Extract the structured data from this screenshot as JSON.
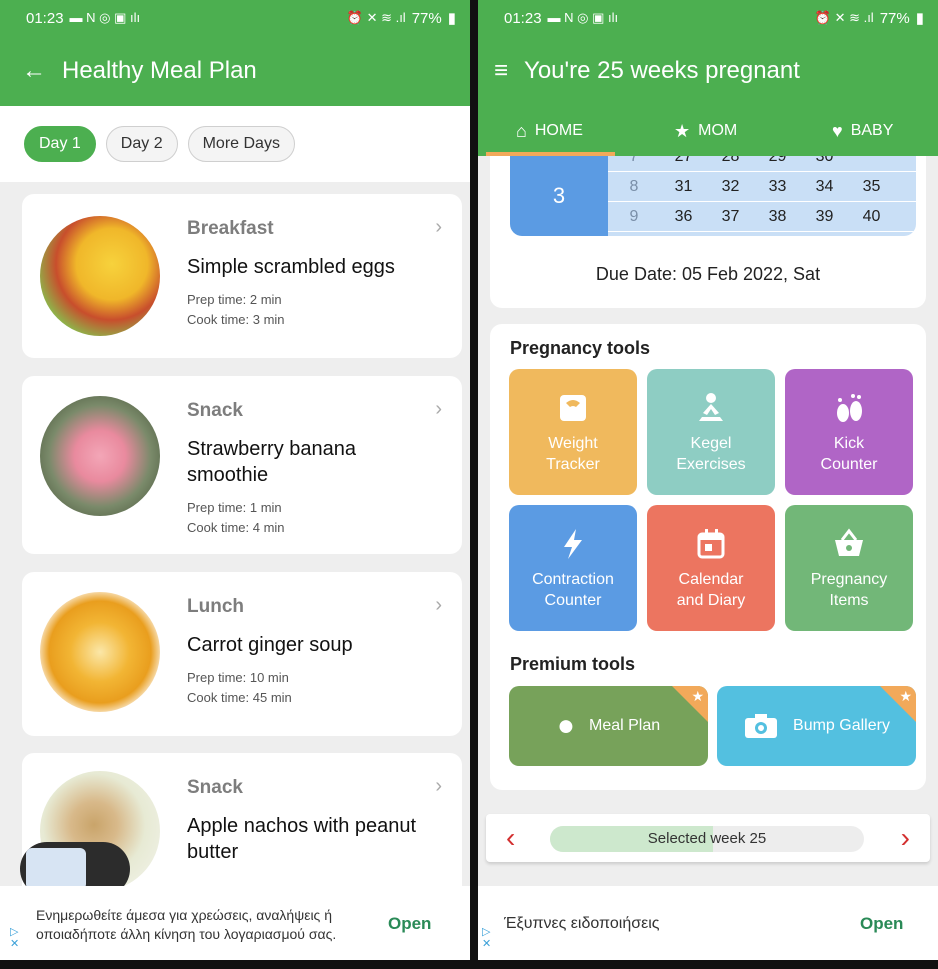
{
  "left": {
    "status": {
      "time": "01:23",
      "battery": "77%"
    },
    "title": "Healthy Meal Plan",
    "days": [
      "Day 1",
      "Day 2",
      "More Days"
    ],
    "meals": [
      {
        "category": "Breakfast",
        "name": "Simple scrambled eggs",
        "prep": "Prep time: 2 min",
        "cook": "Cook time: 3 min"
      },
      {
        "category": "Snack",
        "name": "Strawberry banana smoothie",
        "prep": "Prep time: 1 min",
        "cook": "Cook time: 4 min"
      },
      {
        "category": "Lunch",
        "name": "Carrot ginger soup",
        "prep": "Prep time: 10 min",
        "cook": "Cook time: 45 min"
      },
      {
        "category": "Snack",
        "name": "Apple nachos with peanut butter",
        "prep": "",
        "cook": ""
      }
    ],
    "ad": {
      "text": "Ενημερωθείτε άμεσα για χρεώσεις, αναλήψεις ή οποιαδήποτε άλλη κίνηση του λογαριασμού σας.",
      "open": "Open"
    }
  },
  "right": {
    "status": {
      "time": "01:23",
      "battery": "77%"
    },
    "title": "You're 25 weeks pregnant",
    "tabs": [
      "HOME",
      "MOM",
      "BABY"
    ],
    "calendar": {
      "month": "3",
      "rows": [
        {
          "week": "7",
          "days": [
            "27",
            "28",
            "29",
            "30",
            ""
          ]
        },
        {
          "week": "8",
          "days": [
            "31",
            "32",
            "33",
            "34",
            "35"
          ]
        },
        {
          "week": "9",
          "days": [
            "36",
            "37",
            "38",
            "39",
            "40"
          ]
        }
      ]
    },
    "due_date": "Due Date: 05 Feb 2022, Sat",
    "pregnancy_tools_title": "Pregnancy tools",
    "tools": [
      {
        "line1": "Weight",
        "line2": "Tracker",
        "color": "#f0b95d",
        "icon": "scale-icon"
      },
      {
        "line1": "Kegel",
        "line2": "Exercises",
        "color": "#8ecdc3",
        "icon": "meditation-icon"
      },
      {
        "line1": "Kick",
        "line2": "Counter",
        "color": "#b065c6",
        "icon": "footprint-icon"
      },
      {
        "line1": "Contraction",
        "line2": "Counter",
        "color": "#5b9be3",
        "icon": "lightning-icon"
      },
      {
        "line1": "Calendar",
        "line2": "and Diary",
        "color": "#ec7560",
        "icon": "calendar-icon"
      },
      {
        "line1": "Pregnancy",
        "line2": "Items",
        "color": "#72b778",
        "icon": "basket-icon"
      }
    ],
    "premium_tools_title": "Premium tools",
    "premium": [
      {
        "label": "Meal Plan",
        "color": "#77a25a",
        "icon": "apple-icon"
      },
      {
        "label": "Bump Gallery",
        "color": "#53c0e0",
        "icon": "camera-icon"
      }
    ],
    "week_selector": {
      "label": "Selected week 25",
      "progress": 0.52
    },
    "ad": {
      "text": "Έξυπνες ειδοποιήσεις",
      "open": "Open"
    }
  }
}
